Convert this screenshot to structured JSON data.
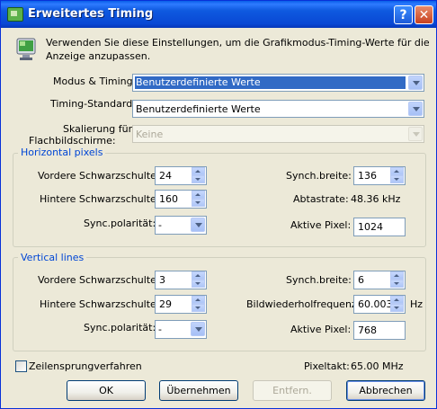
{
  "window": {
    "title": "Erweitertes Timing",
    "help_label": "?",
    "close_label": "✕"
  },
  "intro": {
    "text_line1": "Verwenden Sie diese Einstellungen, um die Grafikmodus-Timing-Werte für die",
    "text_line2": "Anzeige anzupassen."
  },
  "modus": {
    "label": "Modus & Timing:",
    "value": "Benutzerdefinierte Werte"
  },
  "timing_standard": {
    "label": "Timing-Standard:",
    "value": "Benutzerdefinierte Werte"
  },
  "skalierung": {
    "label_line1": "Skalierung für",
    "label_line2": "Flachbildschirme:",
    "value": "Keine"
  },
  "horizontal": {
    "title": "Horizontal pixels",
    "front_porch": {
      "label": "Vordere Schwarzschulter:",
      "value": "24"
    },
    "back_porch": {
      "label": "Hintere Schwarzschulter:",
      "value": "160"
    },
    "sync_polarity": {
      "label": "Sync.polarität:",
      "value": "-"
    },
    "sync_width": {
      "label": "Synch.breite:",
      "value": "136"
    },
    "scan_rate": {
      "label": "Abtastrate:",
      "value": "48.36 kHz"
    },
    "active_pixels": {
      "label": "Aktive Pixel:",
      "value": "1024"
    }
  },
  "vertical": {
    "title": "Vertical lines",
    "front_porch": {
      "label": "Vordere Schwarzschulter:",
      "value": "3"
    },
    "back_porch": {
      "label": "Hintere Schwarzschulter:",
      "value": "29"
    },
    "sync_polarity": {
      "label": "Sync.polarität:",
      "value": "-"
    },
    "sync_width": {
      "label": "Synch.breite:",
      "value": "6"
    },
    "refresh_rate": {
      "label": "Bildwiederholfrequenz:",
      "value": "60.003",
      "unit": "Hz"
    },
    "active_pixels": {
      "label": "Aktive Pixel:",
      "value": "768"
    }
  },
  "interlace": {
    "label": "Zeilensprungverfahren"
  },
  "pixel_clock": {
    "label": "Pixeltakt:",
    "value": "65.00 MHz"
  },
  "buttons": {
    "ok": "OK",
    "apply": "Übernehmen",
    "remove": "Entfern.",
    "cancel": "Abbrechen"
  },
  "colors": {
    "title_bar": "#0A5FE8",
    "selection": "#316AC5",
    "group_title": "#0046D5",
    "face": "#ECE9D8"
  }
}
